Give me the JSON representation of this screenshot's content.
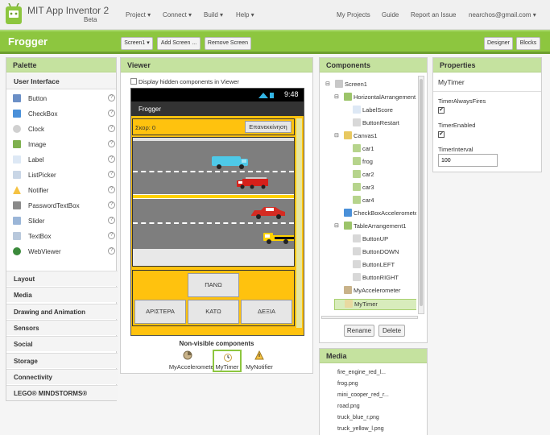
{
  "app": {
    "title": "MIT App Inventor 2",
    "beta": "Beta"
  },
  "nav": {
    "project": "Project ▾",
    "connect": "Connect ▾",
    "build": "Build ▾",
    "help": "Help ▾",
    "my_projects": "My Projects",
    "guide": "Guide",
    "report": "Report an Issue",
    "user": "nearchos@gmail.com ▾"
  },
  "project": {
    "name": "Frogger",
    "screen_button": "Screen1 ▾",
    "add_screen": "Add Screen ...",
    "remove_screen": "Remove Screen",
    "designer": "Designer",
    "blocks": "Blocks"
  },
  "palette": {
    "title": "Palette",
    "ui_heading": "User Interface",
    "items": [
      "Button",
      "CheckBox",
      "Clock",
      "Image",
      "Label",
      "ListPicker",
      "Notifier",
      "PasswordTextBox",
      "Slider",
      "TextBox",
      "WebViewer"
    ],
    "categories": [
      "Layout",
      "Media",
      "Drawing and Animation",
      "Sensors",
      "Social",
      "Storage",
      "Connectivity",
      "LEGO® MINDSTORMS®"
    ],
    "help_glyph": "?"
  },
  "viewer": {
    "title": "Viewer",
    "hidden_label": "Display hidden components in Viewer",
    "status_time": "9:48",
    "app_title": "Frogger",
    "score": "Σκορ: 0",
    "restart": "Επανεκκίνηση",
    "btn_up": "ΠΑΝΩ",
    "btn_left": "ΑΡΙΣΤΕΡΑ",
    "btn_down": "ΚΑΤΩ",
    "btn_right": "ΔΕΞΙΑ",
    "nonvisible_title": "Non-visible components",
    "nonvisible": [
      "MyAccelerometer",
      "MyTimer",
      "MyNotifier"
    ]
  },
  "components": {
    "title": "Components",
    "tree": [
      {
        "label": "Screen1",
        "level": 0,
        "toggle": "⊟"
      },
      {
        "label": "HorizontalArrangement1",
        "level": 1,
        "toggle": "⊟"
      },
      {
        "label": "LabelScore",
        "level": 2,
        "toggle": ""
      },
      {
        "label": "ButtonRestart",
        "level": 2,
        "toggle": ""
      },
      {
        "label": "Canvas1",
        "level": 1,
        "toggle": "⊟"
      },
      {
        "label": "car1",
        "level": 2,
        "toggle": ""
      },
      {
        "label": "frog",
        "level": 2,
        "toggle": ""
      },
      {
        "label": "car2",
        "level": 2,
        "toggle": ""
      },
      {
        "label": "car3",
        "level": 2,
        "toggle": ""
      },
      {
        "label": "car4",
        "level": 2,
        "toggle": ""
      },
      {
        "label": "CheckBoxAccelerometer",
        "level": 1,
        "toggle": ""
      },
      {
        "label": "TableArrangement1",
        "level": 1,
        "toggle": "⊟"
      },
      {
        "label": "ButtonUP",
        "level": 2,
        "toggle": ""
      },
      {
        "label": "ButtonDOWN",
        "level": 2,
        "toggle": ""
      },
      {
        "label": "ButtonLEFT",
        "level": 2,
        "toggle": ""
      },
      {
        "label": "ButtonRIGHT",
        "level": 2,
        "toggle": ""
      },
      {
        "label": "MyAccelerometer",
        "level": 1,
        "toggle": ""
      },
      {
        "label": "MyTimer",
        "level": 1,
        "toggle": "",
        "selected": true
      }
    ],
    "rename": "Rename",
    "delete": "Delete"
  },
  "media": {
    "title": "Media",
    "files": [
      "fire_engine_red_l...",
      "frog.png",
      "mini_cooper_red_r...",
      "road.png",
      "truck_blue_r.png",
      "truck_yellow_l.png"
    ]
  },
  "properties": {
    "title": "Properties",
    "component": "MyTimer",
    "always_fires_label": "TimerAlwaysFires",
    "always_fires": true,
    "enabled_label": "TimerEnabled",
    "enabled": true,
    "interval_label": "TimerInterval",
    "interval": "100",
    "check_glyph": "✔"
  },
  "colors": {
    "accent_green": "#8dc63f",
    "panel_header": "#c5e29f",
    "phone_yellow": "#ffc20e",
    "phone_bar": "#333333"
  }
}
